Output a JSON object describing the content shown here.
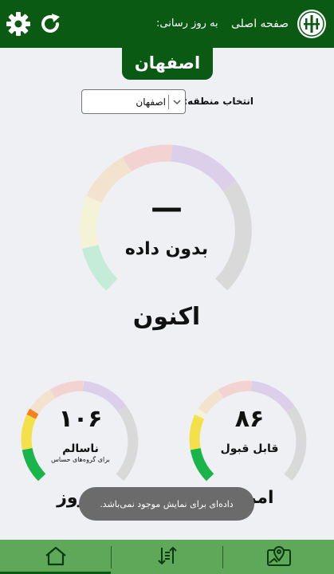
{
  "header": {
    "home_label": "صفحه اصلی",
    "update_label": "به روز رسانی:",
    "logo_icon": "environment-emblem-icon",
    "refresh_icon": "refresh-icon",
    "settings_icon": "gear-icon"
  },
  "city_tab": {
    "label": "اصفهان"
  },
  "region": {
    "label": "انتخاب منطقه:",
    "selected": "اصفهان"
  },
  "gauges": {
    "now": {
      "value": "—",
      "status": "بدون داده",
      "period": "اکنون"
    },
    "today": {
      "value": "۸۶",
      "status": "قابل قبول",
      "period": "امروز"
    },
    "yesterday": {
      "value": "۱۰۶",
      "status": "ناسالم",
      "sub": "برای گروه‌های حساس",
      "period": "دیروز"
    }
  },
  "toast": {
    "text": "داده‌ای برای نمایش موجود نمی‌باشد."
  },
  "nav": {
    "home_icon": "home-icon",
    "sort_icon": "sort-arrows-icon",
    "map_icon": "map-pin-icon"
  },
  "colors": {
    "primary": "#0a5a14",
    "nav_bg": "#5fa85a",
    "background": "#eef0f4"
  }
}
